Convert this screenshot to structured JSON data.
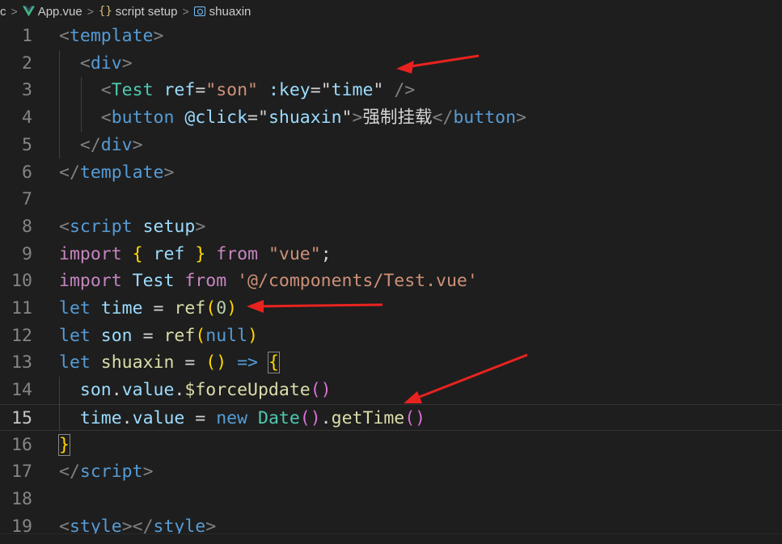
{
  "breadcrumb": {
    "root": "c",
    "file": "App.vue",
    "section": "script setup",
    "symbol": "shuaxin"
  },
  "colors": {
    "background": "#1e1e1e",
    "arrow": "#e8231f",
    "vue_logo": "#41b883"
  },
  "lines": [
    {
      "n": "1",
      "tokens": [
        {
          "t": "<",
          "c": "t-punct"
        },
        {
          "t": "template",
          "c": "t-tag"
        },
        {
          "t": ">",
          "c": "t-punct"
        }
      ]
    },
    {
      "n": "2",
      "tokens": [
        {
          "t": "  ",
          "c": "t-text"
        },
        {
          "t": "<",
          "c": "t-punct"
        },
        {
          "t": "div",
          "c": "t-tag"
        },
        {
          "t": ">",
          "c": "t-punct"
        }
      ]
    },
    {
      "n": "3",
      "tokens": [
        {
          "t": "    ",
          "c": "t-text"
        },
        {
          "t": "<",
          "c": "t-punct"
        },
        {
          "t": "Test",
          "c": "t-comp"
        },
        {
          "t": " ",
          "c": "t-text"
        },
        {
          "t": "ref",
          "c": "t-attr"
        },
        {
          "t": "=",
          "c": "t-eq"
        },
        {
          "t": "\"son\"",
          "c": "t-str"
        },
        {
          "t": " ",
          "c": "t-text"
        },
        {
          "t": ":key",
          "c": "t-attr"
        },
        {
          "t": "=",
          "c": "t-eq"
        },
        {
          "t": "\"",
          "c": "t-text"
        },
        {
          "t": "time",
          "c": "t-var"
        },
        {
          "t": "\"",
          "c": "t-text"
        },
        {
          "t": " ",
          "c": "t-text"
        },
        {
          "t": "/>",
          "c": "t-punct"
        }
      ]
    },
    {
      "n": "4",
      "tokens": [
        {
          "t": "    ",
          "c": "t-text"
        },
        {
          "t": "<",
          "c": "t-punct"
        },
        {
          "t": "button",
          "c": "t-tag"
        },
        {
          "t": " ",
          "c": "t-text"
        },
        {
          "t": "@click",
          "c": "t-attr"
        },
        {
          "t": "=",
          "c": "t-eq"
        },
        {
          "t": "\"",
          "c": "t-text"
        },
        {
          "t": "shuaxin",
          "c": "t-var"
        },
        {
          "t": "\"",
          "c": "t-text"
        },
        {
          "t": ">",
          "c": "t-punct"
        },
        {
          "t": "强制挂载",
          "c": "t-text"
        },
        {
          "t": "</",
          "c": "t-punct"
        },
        {
          "t": "button",
          "c": "t-tag"
        },
        {
          "t": ">",
          "c": "t-punct"
        }
      ]
    },
    {
      "n": "5",
      "tokens": [
        {
          "t": "  ",
          "c": "t-text"
        },
        {
          "t": "</",
          "c": "t-punct"
        },
        {
          "t": "div",
          "c": "t-tag"
        },
        {
          "t": ">",
          "c": "t-punct"
        }
      ]
    },
    {
      "n": "6",
      "tokens": [
        {
          "t": "</",
          "c": "t-punct"
        },
        {
          "t": "template",
          "c": "t-tag"
        },
        {
          "t": ">",
          "c": "t-punct"
        }
      ]
    },
    {
      "n": "7",
      "tokens": []
    },
    {
      "n": "8",
      "tokens": [
        {
          "t": "<",
          "c": "t-punct"
        },
        {
          "t": "script",
          "c": "t-tag"
        },
        {
          "t": " ",
          "c": "t-text"
        },
        {
          "t": "setup",
          "c": "t-attr"
        },
        {
          "t": ">",
          "c": "t-punct"
        }
      ]
    },
    {
      "n": "9",
      "tokens": [
        {
          "t": "import",
          "c": "t-kw"
        },
        {
          "t": " ",
          "c": "t-text"
        },
        {
          "t": "{",
          "c": "t-b1"
        },
        {
          "t": " ",
          "c": "t-text"
        },
        {
          "t": "ref",
          "c": "t-var"
        },
        {
          "t": " ",
          "c": "t-text"
        },
        {
          "t": "}",
          "c": "t-b1"
        },
        {
          "t": " ",
          "c": "t-text"
        },
        {
          "t": "from",
          "c": "t-kw"
        },
        {
          "t": " ",
          "c": "t-text"
        },
        {
          "t": "\"vue\"",
          "c": "t-str"
        },
        {
          "t": ";",
          "c": "t-text"
        }
      ]
    },
    {
      "n": "10",
      "tokens": [
        {
          "t": "import",
          "c": "t-kw"
        },
        {
          "t": " ",
          "c": "t-text"
        },
        {
          "t": "Test",
          "c": "t-var"
        },
        {
          "t": " ",
          "c": "t-text"
        },
        {
          "t": "from",
          "c": "t-kw"
        },
        {
          "t": " ",
          "c": "t-text"
        },
        {
          "t": "'@/components/Test.vue'",
          "c": "t-str"
        }
      ]
    },
    {
      "n": "11",
      "tokens": [
        {
          "t": "let",
          "c": "t-kw2"
        },
        {
          "t": " ",
          "c": "t-text"
        },
        {
          "t": "time",
          "c": "t-var"
        },
        {
          "t": " = ",
          "c": "t-text"
        },
        {
          "t": "ref",
          "c": "t-fn"
        },
        {
          "t": "(",
          "c": "t-b1"
        },
        {
          "t": "0",
          "c": "t-num"
        },
        {
          "t": ")",
          "c": "t-b1"
        }
      ]
    },
    {
      "n": "12",
      "tokens": [
        {
          "t": "let",
          "c": "t-kw2"
        },
        {
          "t": " ",
          "c": "t-text"
        },
        {
          "t": "son",
          "c": "t-var"
        },
        {
          "t": " = ",
          "c": "t-text"
        },
        {
          "t": "ref",
          "c": "t-fn"
        },
        {
          "t": "(",
          "c": "t-b1"
        },
        {
          "t": "null",
          "c": "t-kw2"
        },
        {
          "t": ")",
          "c": "t-b1"
        }
      ]
    },
    {
      "n": "13",
      "tokens": [
        {
          "t": "let",
          "c": "t-kw2"
        },
        {
          "t": " ",
          "c": "t-text"
        },
        {
          "t": "shuaxin",
          "c": "t-fn"
        },
        {
          "t": " = ",
          "c": "t-text"
        },
        {
          "t": "()",
          "c": "t-b1"
        },
        {
          "t": " ",
          "c": "t-text"
        },
        {
          "t": "=>",
          "c": "t-kw2"
        },
        {
          "t": " ",
          "c": "t-text"
        },
        {
          "t": "{",
          "c": "t-b1",
          "hl": true
        }
      ]
    },
    {
      "n": "14",
      "tokens": [
        {
          "t": "  ",
          "c": "t-text"
        },
        {
          "t": "son",
          "c": "t-var"
        },
        {
          "t": ".",
          "c": "t-text"
        },
        {
          "t": "value",
          "c": "t-var"
        },
        {
          "t": ".",
          "c": "t-text"
        },
        {
          "t": "$forceUpdate",
          "c": "t-fn"
        },
        {
          "t": "()",
          "c": "t-b2"
        }
      ]
    },
    {
      "n": "15",
      "current": true,
      "tokens": [
        {
          "t": "  ",
          "c": "t-text"
        },
        {
          "t": "time",
          "c": "t-var"
        },
        {
          "t": ".",
          "c": "t-text"
        },
        {
          "t": "value",
          "c": "t-var"
        },
        {
          "t": " = ",
          "c": "t-text"
        },
        {
          "t": "new",
          "c": "t-kw2"
        },
        {
          "t": " ",
          "c": "t-text"
        },
        {
          "t": "Date",
          "c": "t-cls"
        },
        {
          "t": "()",
          "c": "t-b2"
        },
        {
          "t": ".",
          "c": "t-text"
        },
        {
          "t": "getTime",
          "c": "t-fn"
        },
        {
          "t": "()",
          "c": "t-b2"
        }
      ]
    },
    {
      "n": "16",
      "tokens": [
        {
          "t": "}",
          "c": "t-b1",
          "hl": true
        }
      ]
    },
    {
      "n": "17",
      "tokens": [
        {
          "t": "</",
          "c": "t-punct"
        },
        {
          "t": "script",
          "c": "t-tag"
        },
        {
          "t": ">",
          "c": "t-punct"
        }
      ]
    },
    {
      "n": "18",
      "tokens": []
    },
    {
      "n": "19",
      "tokens": [
        {
          "t": "<",
          "c": "t-punct"
        },
        {
          "t": "style",
          "c": "t-tag"
        },
        {
          "t": "></",
          "c": "t-punct"
        },
        {
          "t": "style",
          "c": "t-tag"
        },
        {
          "t": ">",
          "c": "t-punct"
        }
      ]
    }
  ]
}
